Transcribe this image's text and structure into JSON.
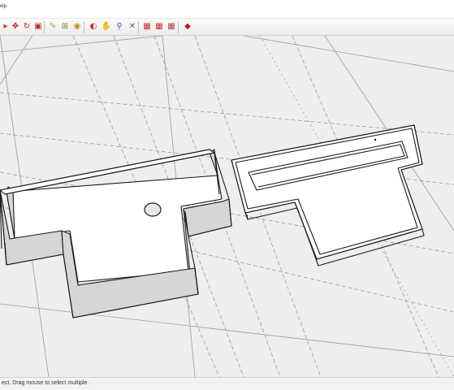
{
  "menubar": {
    "visible_item": "elp"
  },
  "toolbar": {
    "buttons": [
      {
        "icon": "select-arrow-icon",
        "glyph": "▸",
        "color": "#d03030"
      },
      {
        "icon": "move-icon",
        "glyph": "✥",
        "color": "#c02020"
      },
      {
        "icon": "rotate-icon",
        "glyph": "↻",
        "color": "#c02020"
      },
      {
        "icon": "scale-icon",
        "glyph": "▣",
        "color": "#b03020"
      },
      {
        "icon": "tape-measure-icon",
        "glyph": "✎",
        "color": "#c09a20"
      },
      {
        "icon": "dimension-icon",
        "glyph": "⊞",
        "color": "#9a7a30"
      },
      {
        "icon": "paint-bucket-icon",
        "glyph": "◉",
        "color": "#c08a20"
      },
      {
        "icon": "orbit-icon",
        "glyph": "◐",
        "color": "#c03030"
      },
      {
        "icon": "pan-icon",
        "glyph": "✋",
        "color": "#c09a20"
      },
      {
        "icon": "zoom-icon",
        "glyph": "⚲",
        "color": "#3060a0"
      },
      {
        "icon": "zoom-extents-icon",
        "glyph": "✕",
        "color": "#606060"
      },
      {
        "icon": "warehouse-icon",
        "glyph": "▦",
        "color": "#c03030"
      },
      {
        "icon": "share-model-icon",
        "glyph": "▦",
        "color": "#c03030"
      },
      {
        "icon": "components-icon",
        "glyph": "▦",
        "color": "#b04040"
      },
      {
        "icon": "extension-warehouse-icon",
        "glyph": "◆",
        "color": "#c02020"
      }
    ]
  },
  "status": {
    "hint": "ect. Drag mouse to select multiple."
  },
  "colors": {
    "viewport_bg": "#eeeeee",
    "face": "#ffffff",
    "wall_shade": "#d6d6d6",
    "edge": "#1a1a1a",
    "guide": "#9a9a9a"
  }
}
